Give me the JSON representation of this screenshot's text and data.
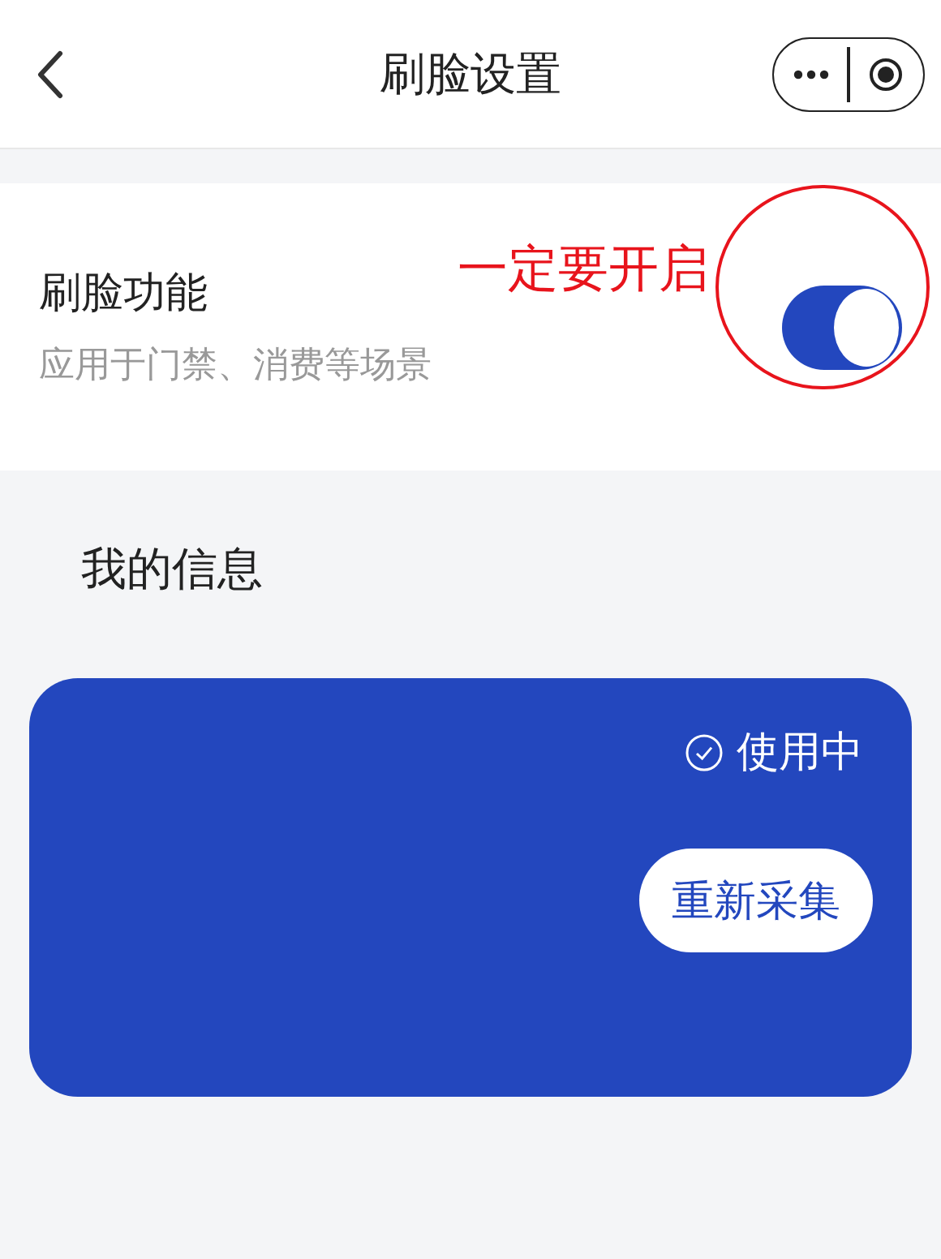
{
  "nav": {
    "title": "刷脸设置"
  },
  "setting": {
    "label": "刷脸功能",
    "description": "应用于门禁、消费等场景",
    "on": true
  },
  "annotation": {
    "text": "一定要开启"
  },
  "section": {
    "title": "我的信息"
  },
  "card": {
    "status": "使用中",
    "button": "重新采集"
  }
}
